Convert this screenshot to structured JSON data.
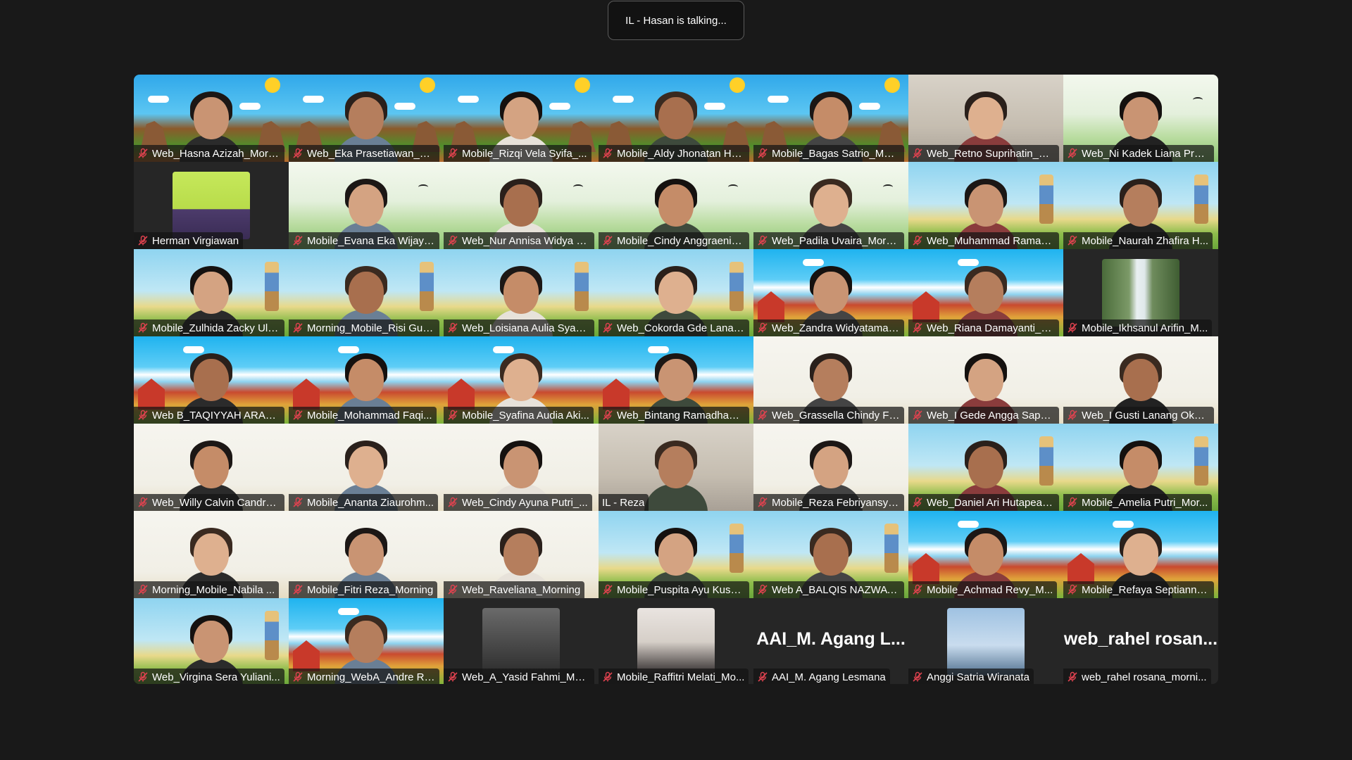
{
  "talking_banner": "IL - Hasan is talking...",
  "participants": [
    {
      "name": "Web_Hasna Azizah_Morni...",
      "bg": "game",
      "muted": true
    },
    {
      "name": "Web_Eka Prasetiawan_M...",
      "bg": "game",
      "muted": true
    },
    {
      "name": "Mobile_Rizqi Vela Syifa_...",
      "bg": "game",
      "muted": true
    },
    {
      "name": "Mobile_Aldy Jhonatan Hu...",
      "bg": "game",
      "muted": true
    },
    {
      "name": "Mobile_Bagas Satrio_Mor...",
      "bg": "game",
      "muted": true
    },
    {
      "name": "Web_Retno Suprihatin_M...",
      "bg": "room",
      "muted": true
    },
    {
      "name": "Web_Ni Kadek Liana Prati...",
      "bg": "maha",
      "muted": true
    },
    {
      "name": "Herman Virgiawan",
      "bg": "dark-panther",
      "muted": true
    },
    {
      "name": "Mobile_Evana Eka Wijaya...",
      "bg": "maha",
      "muted": true
    },
    {
      "name": "Web_Nur Annisa Widya P...",
      "bg": "maha",
      "muted": true
    },
    {
      "name": "Mobile_Cindy Anggraeni_...",
      "bg": "maha",
      "muted": true
    },
    {
      "name": "Web_Padila Uvaira_Morni...",
      "bg": "maha",
      "muted": true
    },
    {
      "name": "Web_Muhammad Ramad...",
      "bg": "farm",
      "muted": true
    },
    {
      "name": "Mobile_Naurah Zhafira H...",
      "bg": "farm",
      "muted": true
    },
    {
      "name": "Mobile_Zulhida Zacky Ulc...",
      "bg": "farm",
      "muted": true
    },
    {
      "name": "Morning_Mobile_Risi Gus...",
      "bg": "farm",
      "muted": true
    },
    {
      "name": "Web_Loisiana Aulia Syahi...",
      "bg": "farm",
      "muted": true
    },
    {
      "name": "Web_Cokorda Gde Lanan...",
      "bg": "farm",
      "muted": true
    },
    {
      "name": "Web_Zandra Widyatamak...",
      "bg": "barn",
      "muted": true
    },
    {
      "name": "Web_Riana Damayanti_M...",
      "bg": "barn",
      "muted": true
    },
    {
      "name": "Mobile_Ikhsanul Arifin_M...",
      "bg": "dark-waterfall",
      "muted": true
    },
    {
      "name": "Web B_TAQIYYAH ARAFA...",
      "bg": "barn",
      "muted": true
    },
    {
      "name": "Mobile_Mohammad Faqi...",
      "bg": "barn",
      "muted": true
    },
    {
      "name": "Mobile_Syafina Audia Aki...",
      "bg": "barn",
      "muted": true
    },
    {
      "name": "Web_Bintang Ramadhan_...",
      "bg": "barn",
      "muted": true
    },
    {
      "name": "Web_Grassella Chindy Fr...",
      "bg": "grofy",
      "muted": true
    },
    {
      "name": "Web_I Gede Angga Saput...",
      "bg": "grofy",
      "muted": true
    },
    {
      "name": "Web_I Gusti Lanang Oka ...",
      "bg": "grofy",
      "muted": true
    },
    {
      "name": "Web_Willy Calvin Candra ...",
      "bg": "grofy",
      "muted": true
    },
    {
      "name": "Mobile_Ananta Ziaurohm...",
      "bg": "grofy",
      "muted": true
    },
    {
      "name": "Web_Cindy Ayuna Putri_...",
      "bg": "grofy",
      "muted": true
    },
    {
      "name": "IL - Reza",
      "bg": "room",
      "muted": false
    },
    {
      "name": "Mobile_Reza Febriyansya...",
      "bg": "grofy",
      "muted": true
    },
    {
      "name": "Web_Daniel Ari Hutapea_...",
      "bg": "farm",
      "muted": true
    },
    {
      "name": "Mobile_Amelia Putri_Mor...",
      "bg": "farm",
      "muted": true
    },
    {
      "name": "Morning_Mobile_Nabila ...",
      "bg": "grofy",
      "muted": true
    },
    {
      "name": "Mobile_Fitri Reza_Morning",
      "bg": "grofy",
      "muted": true
    },
    {
      "name": "Web_Raveliana_Morning",
      "bg": "grofy",
      "muted": true
    },
    {
      "name": "Mobile_Puspita Ayu Kusu...",
      "bg": "farm",
      "muted": true
    },
    {
      "name": "Web A_BALQIS NAZWA K...",
      "bg": "farm",
      "muted": true
    },
    {
      "name": "Mobile_Achmad Revy_M...",
      "bg": "barn",
      "muted": true
    },
    {
      "name": "Mobile_Refaya Septianno...",
      "bg": "barn",
      "muted": true
    },
    {
      "name": "Web_Virgina Sera Yuliani...",
      "bg": "farm",
      "muted": true
    },
    {
      "name": "Morning_WebA_Andre Ra...",
      "bg": "barn",
      "muted": true
    },
    {
      "name": "Web_A_Yasid Fahmi_Mor...",
      "bg": "dark-selfie",
      "muted": true
    },
    {
      "name": "Mobile_Raffitri Melati_Mo...",
      "bg": "dark-girl",
      "muted": true
    },
    {
      "name": "AAI_M. Agang Lesmana",
      "bg": "dark",
      "muted": true,
      "display_name": "AAI_M. Agang L..."
    },
    {
      "name": "Anggi Satria Wiranata",
      "bg": "dark-beach",
      "muted": true
    },
    {
      "name": "web_rahel rosana_morni...",
      "bg": "dark",
      "muted": true,
      "display_name": "web_rahel rosan..."
    }
  ],
  "colors": {
    "background": "#191919",
    "mic_muted": "#e0424f",
    "label_text": "#ffffff"
  }
}
